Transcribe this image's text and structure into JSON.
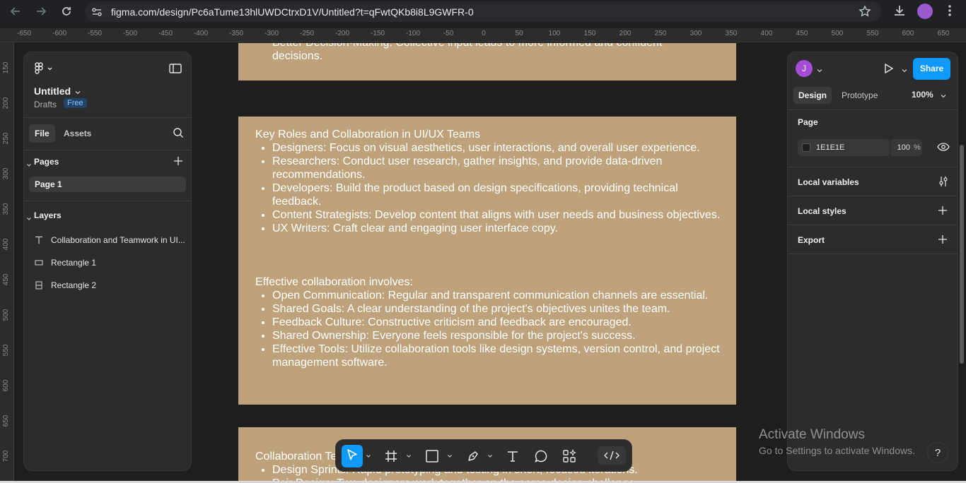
{
  "browser": {
    "url": "figma.com/design/Pc6aTume13hlUWDCtrxD1V/Untitled?t=qFwtQKb8i8L9GWFR-0"
  },
  "rulers": {
    "top": [
      "-650",
      "-600",
      "-550",
      "-500",
      "-450",
      "-400",
      "-350",
      "-300",
      "-250",
      "-200",
      "-150",
      "-100",
      "-50",
      "0",
      "50",
      "100",
      "150",
      "200",
      "250",
      "300",
      "350",
      "400",
      "450",
      "500",
      "550",
      "600",
      "650"
    ],
    "left": [
      "150",
      "200",
      "250",
      "300",
      "350",
      "400",
      "450",
      "500",
      "550",
      "600",
      "650",
      "700"
    ]
  },
  "left_panel": {
    "file_title": "Untitled",
    "location": "Drafts",
    "plan_badge": "Free",
    "tabs": [
      "File",
      "Assets"
    ],
    "pages_label": "Pages",
    "pages": [
      "Page 1"
    ],
    "layers_label": "Layers",
    "layers": [
      {
        "name": "Collaboration and Teamwork in UI...",
        "icon": "text-icon"
      },
      {
        "name": "Rectangle 1",
        "icon": "rectangle-icon"
      },
      {
        "name": "Rectangle 2",
        "icon": "frame-icon"
      }
    ]
  },
  "canvas": {
    "frame_top": {
      "lines": [
        "Better Decision-Making: Collective input leads to more informed and confident",
        "decisions."
      ]
    },
    "frame_middle": {
      "heading1": "Key Roles and Collaboration in UI/UX Teams",
      "roles": [
        "Designers: Focus on visual aesthetics, user interactions, and overall user experience.",
        "Researchers: Conduct user research, gather insights, and provide data-driven recommendations.",
        "Developers: Build the product based on design specifications, providing technical feedback.",
        "Content Strategists: Develop content that aligns with user needs and business objectives.",
        "UX Writers: Craft clear and engaging user interface copy."
      ],
      "heading2": "Effective collaboration involves:",
      "practices": [
        "Open Communication: Regular and transparent communication channels are essential.",
        "Shared Goals: A clear understanding of the project's objectives unites the team.",
        "Feedback Culture: Constructive criticism and feedback are encouraged.",
        "Shared Ownership: Everyone feels responsible for the project's success.",
        "Effective Tools: Utilize collaboration tools like design systems, version control, and project management software."
      ]
    },
    "frame_bottom": {
      "heading": "Collaboration Techniques",
      "items": [
        "Design Sprints: Rapid prototyping and testing in short, focused iterations.",
        "Pair Design: Two designers work together on the same design challenge."
      ]
    }
  },
  "right_panel": {
    "avatar_initial": "J",
    "share_label": "Share",
    "tabs": [
      "Design",
      "Prototype"
    ],
    "zoom": "100%",
    "page_heading": "Page",
    "bg_hex": "1E1E1E",
    "bg_opacity": "100",
    "opacity_unit": "%",
    "sections": [
      "Local variables",
      "Local styles",
      "Export"
    ]
  },
  "watermark": {
    "title": "Activate Windows",
    "subtitle": "Go to Settings to activate Windows."
  },
  "help_label": "?",
  "colors": {
    "frame_fill": "#bda27b",
    "accent": "#0d99ff",
    "canvas_bg": "#1e1e1e",
    "panel_bg": "#2c2c2c"
  }
}
